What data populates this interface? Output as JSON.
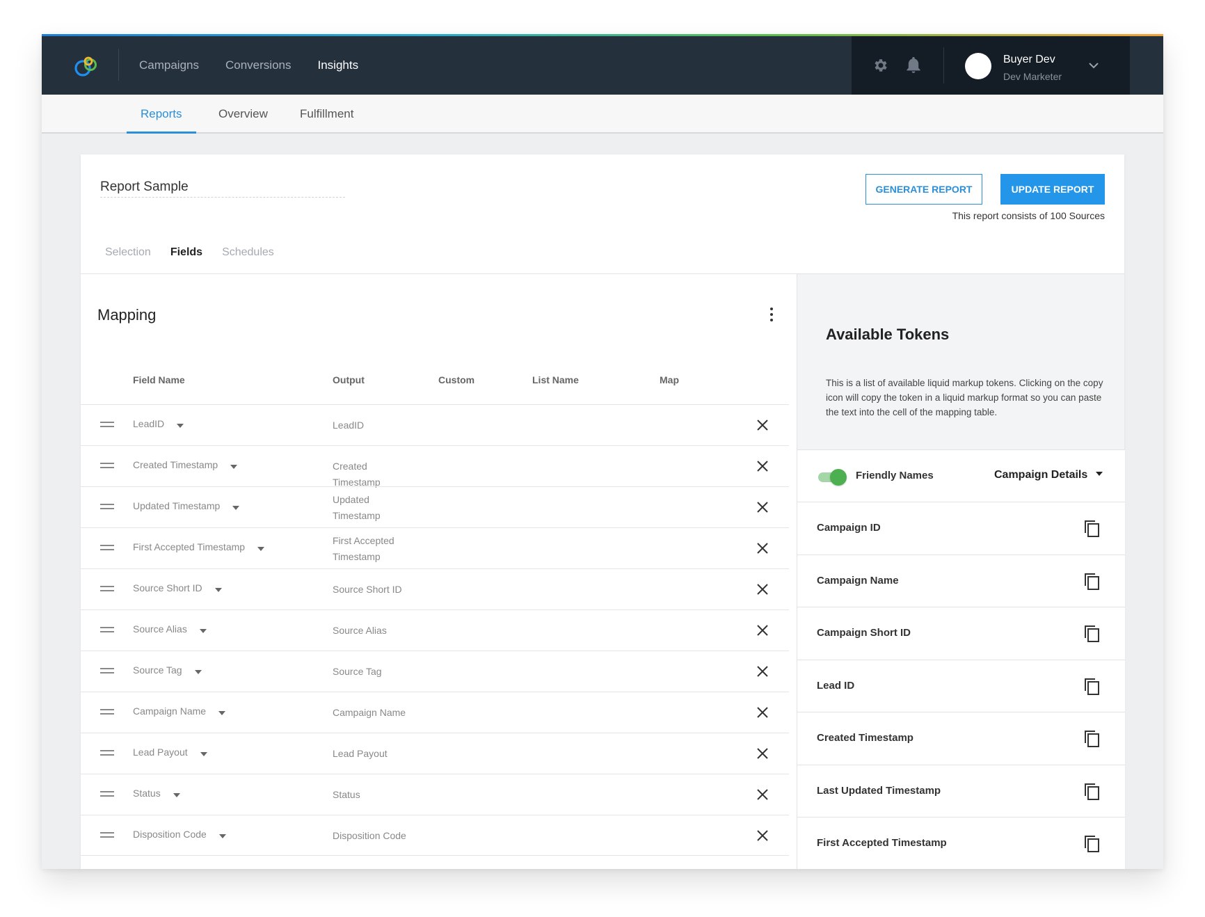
{
  "app": {
    "nav": [
      {
        "label": "Campaigns",
        "active": false
      },
      {
        "label": "Conversions",
        "active": false
      },
      {
        "label": "Insights",
        "active": true
      }
    ],
    "user": {
      "name": "Buyer Dev",
      "role": "Dev Marketer"
    }
  },
  "subnav": [
    {
      "label": "Reports",
      "active": true
    },
    {
      "label": "Overview",
      "active": false
    },
    {
      "label": "Fulfillment",
      "active": false
    }
  ],
  "report": {
    "title": "Report Sample",
    "generate_label": "GENERATE REPORT",
    "update_label": "UPDATE REPORT",
    "note": "This report consists of 100 Sources",
    "tabs": [
      {
        "label": "Selection",
        "active": false
      },
      {
        "label": "Fields",
        "active": true
      },
      {
        "label": "Schedules",
        "active": false
      }
    ]
  },
  "mapping": {
    "title": "Mapping",
    "columns": [
      "Field Name",
      "Output",
      "Custom",
      "List Name",
      "Map"
    ],
    "rows": [
      {
        "field": "LeadID",
        "output": "LeadID"
      },
      {
        "field": "Created Timestamp",
        "output": "Created Timestamp"
      },
      {
        "field": "Updated Timestamp",
        "output": "Updated Timestamp"
      },
      {
        "field": "First Accepted Timestamp",
        "output": "First Accepted Timestamp"
      },
      {
        "field": "Source Short ID",
        "output": "Source Short ID"
      },
      {
        "field": "Source Alias",
        "output": "Source Alias"
      },
      {
        "field": "Source Tag",
        "output": "Source Tag"
      },
      {
        "field": "Campaign Name",
        "output": "Campaign Name"
      },
      {
        "field": "Lead Payout",
        "output": "Lead Payout"
      },
      {
        "field": "Status",
        "output": "Status"
      },
      {
        "field": "Disposition Code",
        "output": "Disposition Code"
      }
    ]
  },
  "tokens": {
    "title": "Available Tokens",
    "description": "This is a list of available liquid markup tokens. Clicking on the copy icon will copy the token in a liquid markup format so you can paste the text into the cell of the mapping table.",
    "friendly_names_label": "Friendly Names",
    "friendly_names_on": true,
    "category": "Campaign Details",
    "items": [
      "Campaign ID",
      "Campaign Name",
      "Campaign Short ID",
      "Lead ID",
      "Created Timestamp",
      "Last Updated Timestamp",
      "First Accepted Timestamp"
    ]
  },
  "colors": {
    "accent": "#2a8fd8",
    "topbar": "#25303d",
    "toggle_on": "#4caf50"
  }
}
